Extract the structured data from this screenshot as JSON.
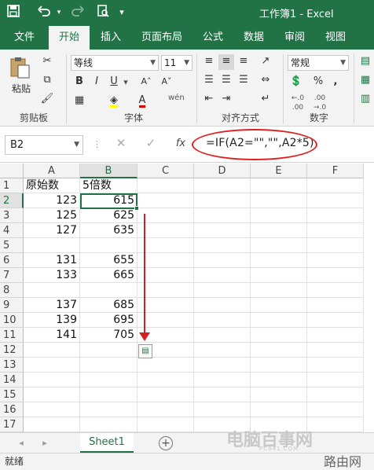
{
  "app": {
    "title": "工作簿1 - Excel"
  },
  "quick_access": {
    "save_icon": "save-icon",
    "undo_icon": "undo-icon",
    "redo_icon": "redo-icon",
    "preview_icon": "print-preview-icon",
    "customize_icon": "chevron-down-icon"
  },
  "ribbon_tabs": [
    {
      "label": "文件"
    },
    {
      "label": "开始"
    },
    {
      "label": "插入"
    },
    {
      "label": "页面布局"
    },
    {
      "label": "公式"
    },
    {
      "label": "数据"
    },
    {
      "label": "审阅"
    },
    {
      "label": "视图"
    }
  ],
  "active_tab": "开始",
  "ribbon": {
    "clipboard": {
      "label": "剪贴板",
      "paste_label": "粘贴"
    },
    "font": {
      "label": "字体",
      "font_name": "等线",
      "font_size": "11",
      "bold": "B",
      "italic": "I",
      "underline": "U",
      "wen": "wén"
    },
    "align": {
      "label": "对齐方式"
    },
    "number": {
      "label": "数字",
      "format": "常规",
      "pct": "%",
      "comma": ",",
      "inc_dec": "←.0\n.00",
      "dec_dec": ".00\n→.0"
    }
  },
  "formula_bar": {
    "name_box": "B2",
    "fx": "fx",
    "formula": "=IF(A2=\"\",\"\",A2*5)"
  },
  "columns": [
    "A",
    "B",
    "C",
    "D",
    "E",
    "F"
  ],
  "rows": [
    "1",
    "2",
    "3",
    "4",
    "5",
    "6",
    "7",
    "8",
    "9",
    "10",
    "11",
    "12",
    "13",
    "14",
    "15",
    "16",
    "17"
  ],
  "cells": {
    "A1": "原始数",
    "B1": "5倍数",
    "A2": "123",
    "B2": "615",
    "A3": "125",
    "B3": "625",
    "A4": "127",
    "B4": "635",
    "A6": "131",
    "B6": "655",
    "A7": "133",
    "B7": "665",
    "A9": "137",
    "B9": "685",
    "A10": "139",
    "B10": "695",
    "A11": "141",
    "B11": "705"
  },
  "sheets": [
    {
      "name": "Sheet1"
    }
  ],
  "status": {
    "text": "就绪"
  },
  "watermark": {
    "brand": "电脑百事网",
    "site": "PC841.COM",
    "corner": "路由网"
  }
}
